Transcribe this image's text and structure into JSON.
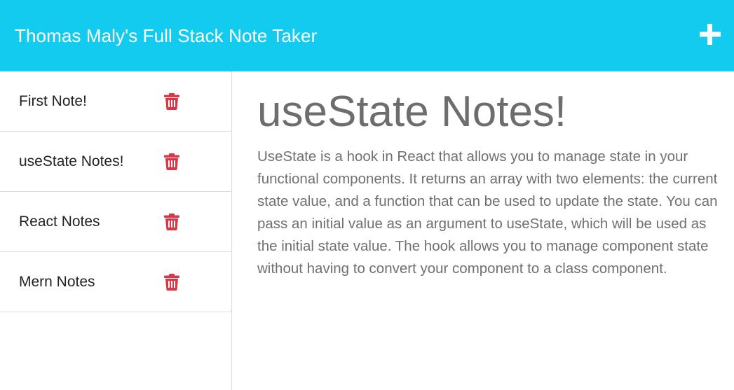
{
  "header": {
    "title": "Thomas Maly's Full Stack Note Taker",
    "new_note_icon": "plus-icon"
  },
  "sidebar": {
    "notes": [
      {
        "title": "First Note!",
        "icon": "trash-icon"
      },
      {
        "title": "useState Notes!",
        "icon": "trash-icon"
      },
      {
        "title": "React Notes",
        "icon": "trash-icon"
      },
      {
        "title": "Mern Notes",
        "icon": "trash-icon"
      }
    ]
  },
  "main": {
    "note_title": "useState Notes!",
    "note_text": "UseState is a hook in React that allows you to manage state in your functional components. It returns an array with two elements: the current state value, and a function that can be used to update the state. You can pass an initial value as an argument to useState, which will be used as the initial state value. The hook allows you to manage component state without having to convert your component to a class component."
  },
  "colors": {
    "navbar": "#12cbee",
    "delete": "#dc3545",
    "heading_text": "#6d6d6d"
  }
}
